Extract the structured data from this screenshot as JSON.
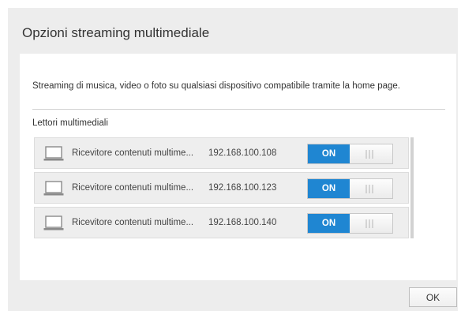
{
  "dialog": {
    "title": "Opzioni streaming multimediale",
    "description": "Streaming di musica, video o foto su qualsiasi dispositivo compatibile tramite la home page.",
    "section_label": "Lettori multimediali",
    "ok_label": "OK"
  },
  "players": [
    {
      "name": "Ricevitore contenuti multime...",
      "ip": "192.168.100.108",
      "toggle_label": "ON",
      "icon": "laptop-icon"
    },
    {
      "name": "Ricevitore contenuti multime...",
      "ip": "192.168.100.123",
      "toggle_label": "ON",
      "icon": "laptop-icon"
    },
    {
      "name": "Ricevitore contenuti multime...",
      "ip": "192.168.100.140",
      "toggle_label": "ON",
      "icon": "laptop-icon"
    }
  ],
  "colors": {
    "accent": "#1f86d2",
    "dialog_bg": "#ededed",
    "row_bg": "#eeeeee"
  }
}
